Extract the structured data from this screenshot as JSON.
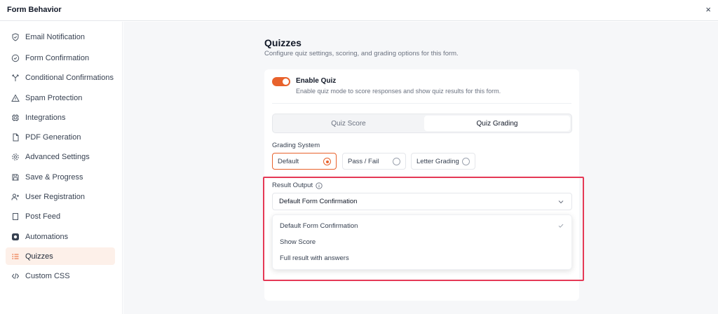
{
  "window": {
    "title": "Form Behavior",
    "close_label": "×"
  },
  "sidebar": {
    "items": [
      {
        "label": "Email Notification",
        "icon": "shield-check-icon"
      },
      {
        "label": "Form Confirmation",
        "icon": "check-circle-icon"
      },
      {
        "label": "Conditional Confirmations",
        "icon": "branch-icon"
      },
      {
        "label": "Spam Protection",
        "icon": "warning-icon"
      },
      {
        "label": "Integrations",
        "icon": "chip-icon"
      },
      {
        "label": "PDF Generation",
        "icon": "document-icon"
      },
      {
        "label": "Advanced Settings",
        "icon": "gear-icon"
      },
      {
        "label": "Save & Progress",
        "icon": "save-icon"
      },
      {
        "label": "User Registration",
        "icon": "user-plus-icon"
      },
      {
        "label": "Post Feed",
        "icon": "post-icon"
      },
      {
        "label": "Automations",
        "icon": "automation-icon"
      },
      {
        "label": "Quizzes",
        "icon": "list-icon",
        "active": true
      },
      {
        "label": "Custom CSS",
        "icon": "code-icon"
      }
    ]
  },
  "main": {
    "title": "Quizzes",
    "subtitle": "Configure quiz settings, scoring, and grading options for this form.",
    "enable": {
      "label": "Enable Quiz",
      "description": "Enable quiz mode to score responses and show quiz results for this form.",
      "on": true
    },
    "tabs": [
      {
        "label": "Quiz Score",
        "active": false
      },
      {
        "label": "Quiz Grading",
        "active": true
      }
    ],
    "grading": {
      "label": "Grading System",
      "options": [
        {
          "label": "Default",
          "selected": true
        },
        {
          "label": "Pass / Fail",
          "selected": false
        },
        {
          "label": "Letter Grading",
          "selected": false
        }
      ]
    },
    "result_output": {
      "label": "Result Output",
      "selected": "Default Form Confirmation",
      "options": [
        {
          "label": "Default Form Confirmation",
          "checked": true
        },
        {
          "label": "Show Score",
          "checked": false
        },
        {
          "label": "Full result with answers",
          "checked": false
        }
      ]
    }
  },
  "colors": {
    "accent": "#e8622c",
    "active_bg": "#fdf0e9",
    "highlight": "#e53956",
    "main_bg": "#f6f7f9"
  }
}
